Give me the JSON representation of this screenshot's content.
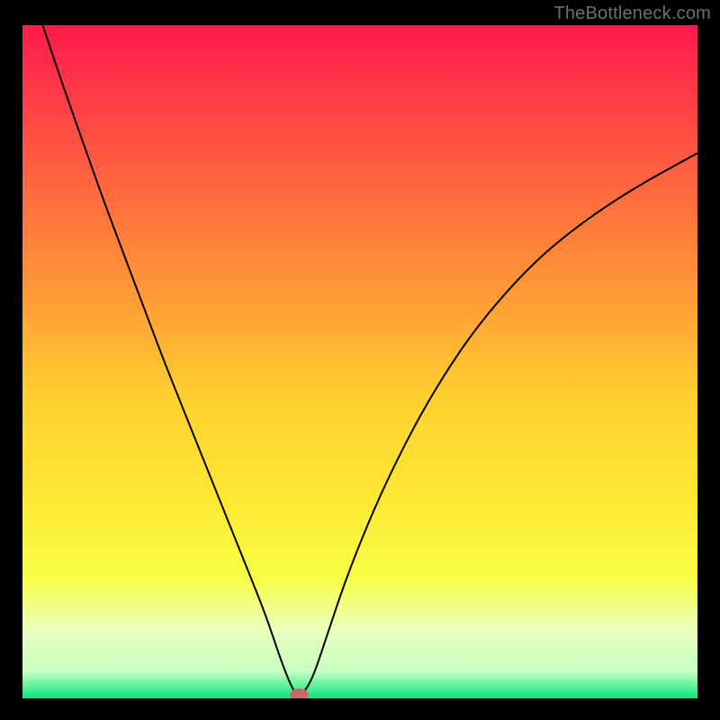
{
  "watermark": "TheBottleneck.com",
  "chart_data": {
    "type": "line",
    "title": "",
    "xlabel": "",
    "ylabel": "",
    "xlim": [
      0,
      100
    ],
    "ylim": [
      0,
      100
    ],
    "gradient_stops": [
      {
        "offset": 0.0,
        "color": "#ff1a4b"
      },
      {
        "offset": 0.1,
        "color": "#ff3a47"
      },
      {
        "offset": 0.25,
        "color": "#ff6b3e"
      },
      {
        "offset": 0.4,
        "color": "#ff9a36"
      },
      {
        "offset": 0.55,
        "color": "#ffcf30"
      },
      {
        "offset": 0.7,
        "color": "#ffe733"
      },
      {
        "offset": 0.82,
        "color": "#f7ff44"
      },
      {
        "offset": 0.9,
        "color": "#eaffbe"
      },
      {
        "offset": 0.96,
        "color": "#c4ffc0"
      },
      {
        "offset": 1.0,
        "color": "#07e67e"
      }
    ],
    "series": [
      {
        "name": "curve",
        "color": "#000000",
        "x": [
          3.0,
          6.0,
          9.0,
          12.0,
          15.0,
          18.0,
          21.0,
          24.0,
          27.0,
          30.0,
          33.0,
          36.0,
          38.0,
          39.5,
          40.5,
          41.5,
          43.0,
          45.0,
          48.0,
          52.0,
          56.0,
          60.0,
          65.0,
          70.0,
          76.0,
          82.0,
          90.0,
          100.0
        ],
        "y": [
          100.0,
          91.0,
          82.5,
          74.0,
          66.0,
          58.0,
          50.0,
          42.5,
          35.0,
          27.5,
          20.0,
          12.5,
          6.5,
          2.5,
          0.6,
          0.6,
          3.0,
          9.0,
          18.0,
          28.0,
          36.5,
          44.0,
          52.0,
          58.5,
          65.0,
          70.0,
          75.5,
          81.0
        ]
      }
    ],
    "marker": {
      "x": 41.0,
      "y": 0.6,
      "rx": 1.4,
      "ry": 0.85,
      "fill": "#c86a63"
    }
  }
}
